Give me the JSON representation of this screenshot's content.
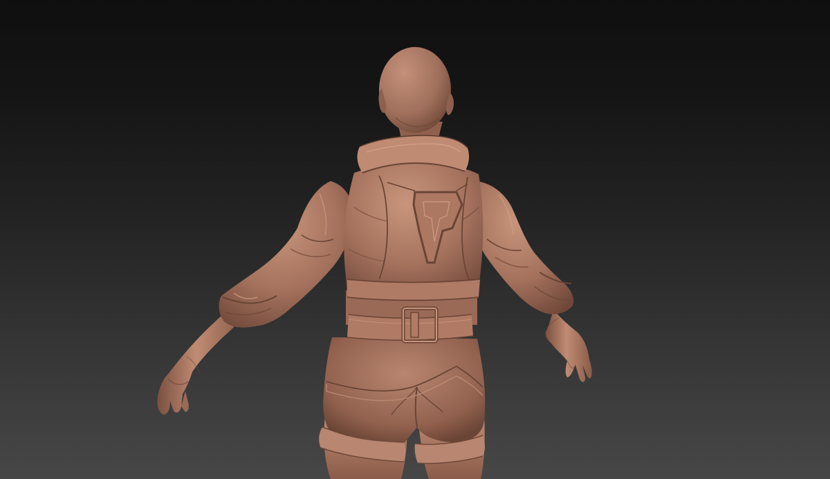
{
  "scene": {
    "subject": "sculpt-figure",
    "view": "back",
    "colors": {
      "background_top": "#0f0f0f",
      "background_bottom": "#474747",
      "clay_base": "#a2705c",
      "clay_light": "#c8957c",
      "clay_mid": "#b17c65",
      "clay_shadow": "#6e4737",
      "clay_deep": "#4f3226"
    }
  }
}
